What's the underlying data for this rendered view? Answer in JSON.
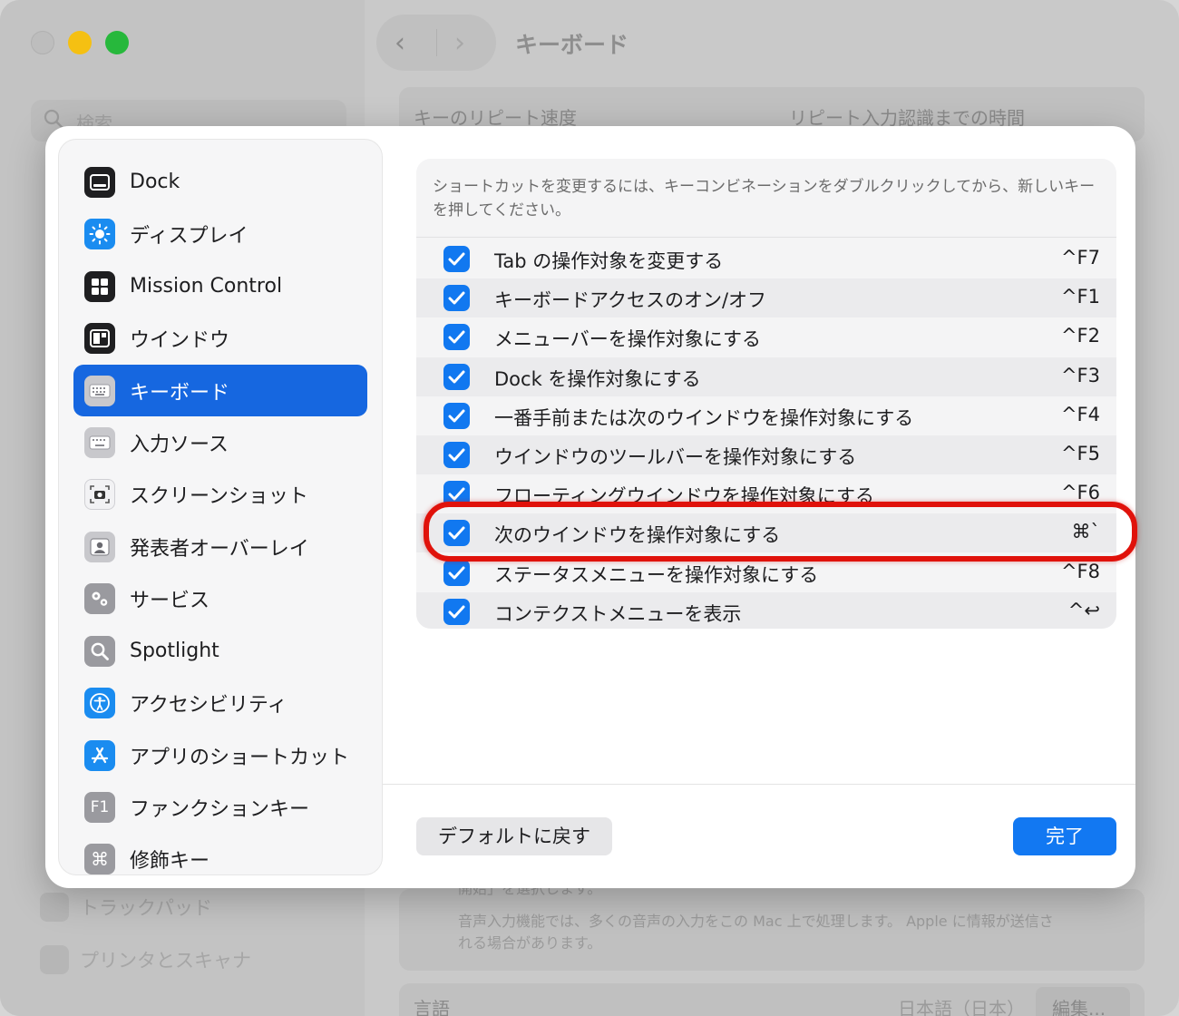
{
  "background": {
    "window_title": "キーボード",
    "search_placeholder": "検索",
    "label_repeat_speed": "キーのリピート速度",
    "label_repeat_delay": "リピート入力認識までの時間",
    "voice_text_partial": "開始」を選択します。",
    "voice_text": "音声入力機能では、多くの音声の入力をこの Mac 上で処理します。 Apple に情報が送信される場合があります。",
    "language_label": "言語",
    "language_value": "日本語（日本）",
    "edit_button": "編集...",
    "sidebar_items": [
      "トラックパッド",
      "プリンタとスキャナ"
    ]
  },
  "sidebar": {
    "items": [
      {
        "label": "Dock",
        "icon": "dock-icon"
      },
      {
        "label": "ディスプレイ",
        "icon": "display-brightness-icon"
      },
      {
        "label": "Mission Control",
        "icon": "mission-control-icon"
      },
      {
        "label": "ウインドウ",
        "icon": "window-icon"
      },
      {
        "label": "キーボード",
        "icon": "keyboard-icon",
        "selected": true
      },
      {
        "label": "入力ソース",
        "icon": "input-source-icon"
      },
      {
        "label": "スクリーンショット",
        "icon": "screenshot-icon"
      },
      {
        "label": "発表者オーバーレイ",
        "icon": "presenter-overlay-icon"
      },
      {
        "label": "サービス",
        "icon": "services-gears-icon"
      },
      {
        "label": "Spotlight",
        "icon": "spotlight-magnifier-icon"
      },
      {
        "label": "アクセシビリティ",
        "icon": "accessibility-icon"
      },
      {
        "label": "アプリのショートカット",
        "icon": "app-store-icon"
      },
      {
        "label": "ファンクションキー",
        "icon": "f1-key-icon"
      },
      {
        "label": "修飾キー",
        "icon": "command-key-icon"
      }
    ]
  },
  "content": {
    "description": "ショートカットを変更するには、キーコンビネーションをダブルクリックしてから、新しいキーを押してください。",
    "shortcuts": [
      {
        "label": "Tab の操作対象を変更する",
        "key": "^F7",
        "checked": true
      },
      {
        "label": "キーボードアクセスのオン/オフ",
        "key": "^F1",
        "checked": true
      },
      {
        "label": "メニューバーを操作対象にする",
        "key": "^F2",
        "checked": true
      },
      {
        "label": "Dock を操作対象にする",
        "key": "^F3",
        "checked": true
      },
      {
        "label": "一番手前または次のウインドウを操作対象にする",
        "key": "^F4",
        "checked": true
      },
      {
        "label": "ウインドウのツールバーを操作対象にする",
        "key": "^F5",
        "checked": true
      },
      {
        "label": "フローティングウインドウを操作対象にする",
        "key": "^F6",
        "checked": true
      },
      {
        "label": "次のウインドウを操作対象にする",
        "key": "⌘`",
        "checked": true
      },
      {
        "label": "ステータスメニューを操作対象にする",
        "key": "^F8",
        "checked": true
      },
      {
        "label": "コンテクストメニューを表示",
        "key": "^↩",
        "checked": true
      }
    ]
  },
  "footer": {
    "default_button": "デフォルトに戻す",
    "done_button": "完了"
  },
  "colors": {
    "accent": "#1278f2",
    "selected": "#1667e0",
    "highlight": "#e0120b"
  }
}
